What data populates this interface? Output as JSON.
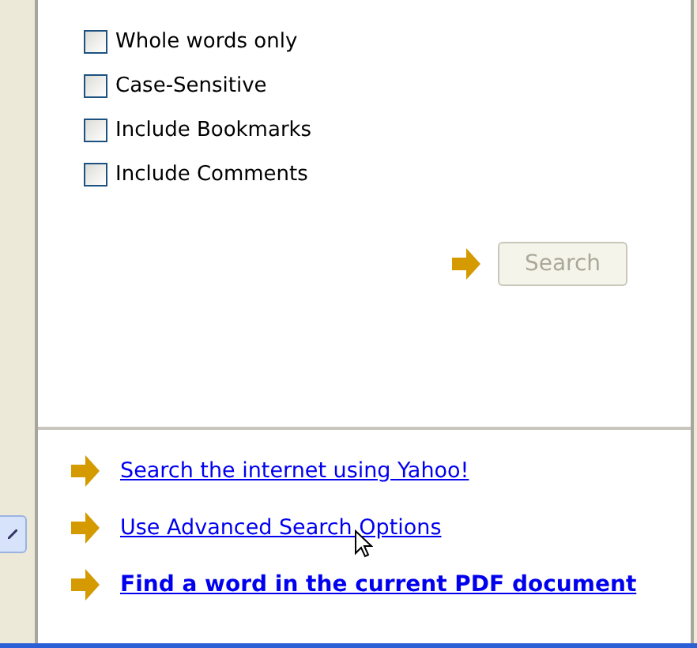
{
  "options": [
    {
      "label": "Whole words only",
      "checked": false
    },
    {
      "label": "Case-Sensitive",
      "checked": false
    },
    {
      "label": "Include Bookmarks",
      "checked": false
    },
    {
      "label": "Include Comments",
      "checked": false
    }
  ],
  "search_button": {
    "label": "Search",
    "disabled": true
  },
  "links": [
    {
      "label": "Search the internet using Yahoo!",
      "emphasized": false
    },
    {
      "label": "Use Advanced Search Options",
      "emphasized": false
    },
    {
      "label": "Find a word in the current PDF document",
      "emphasized": true
    }
  ]
}
